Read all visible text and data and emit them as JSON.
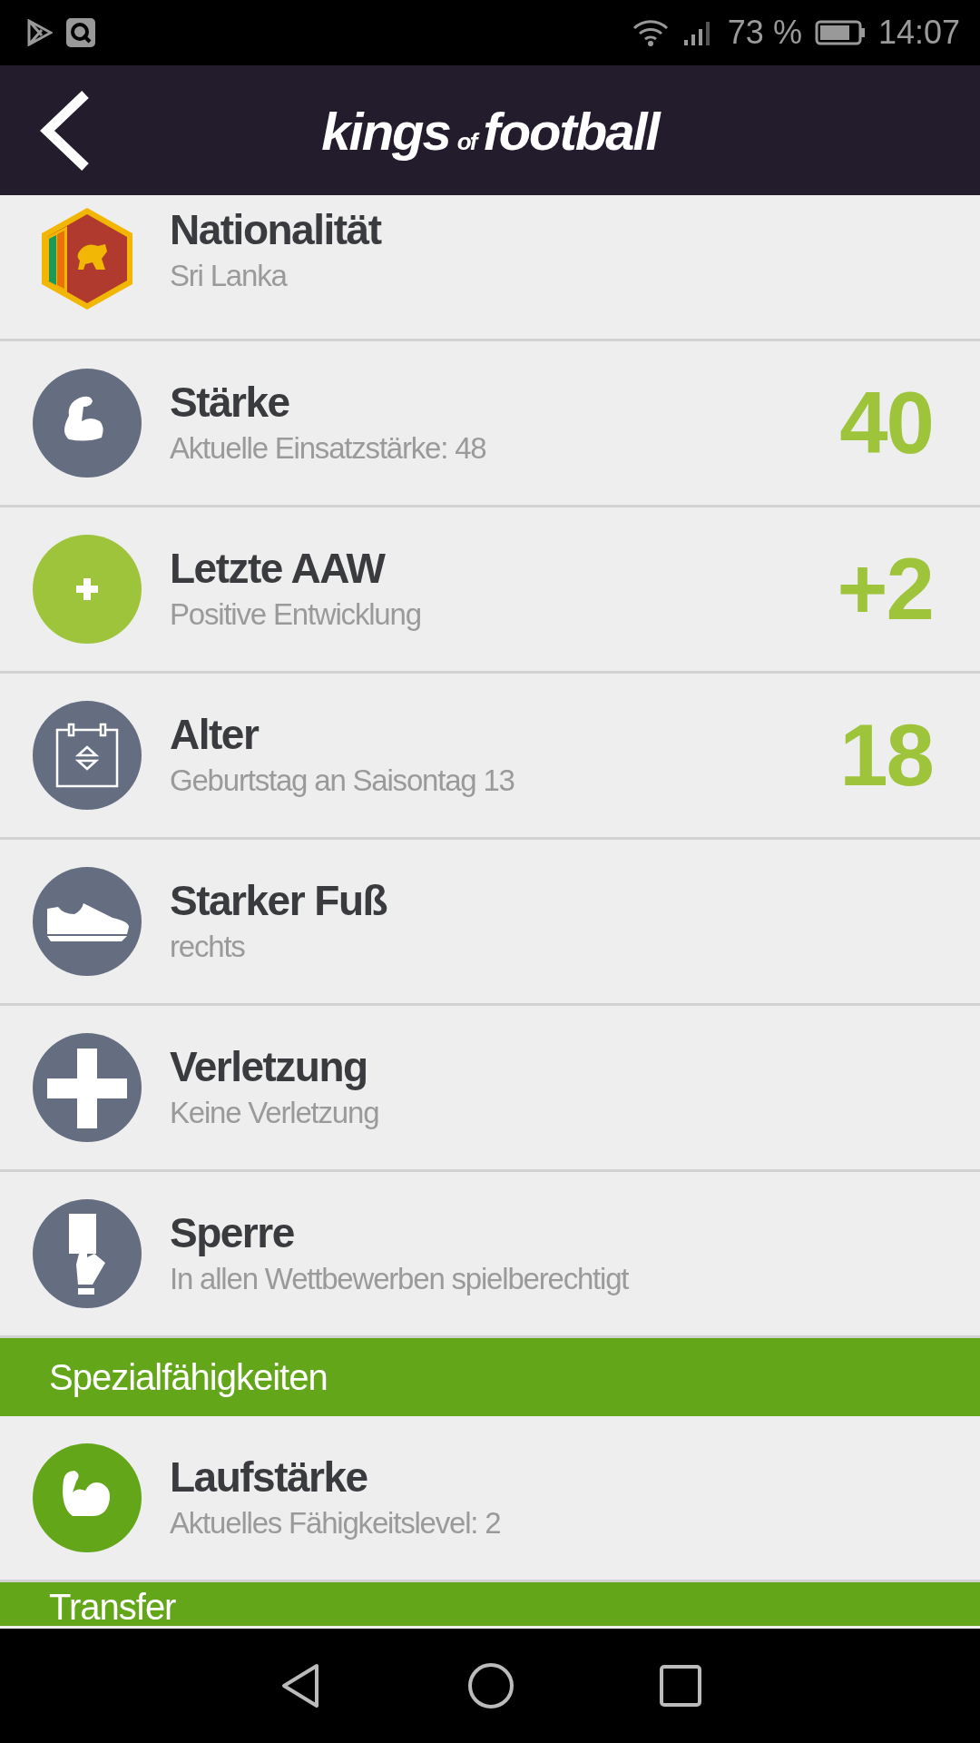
{
  "status_bar": {
    "battery": "73 %",
    "time": "14:07"
  },
  "header": {
    "logo": [
      {
        "text": "kings",
        "kind": "main"
      },
      {
        "text": "of",
        "kind": "small"
      },
      {
        "text": "football",
        "kind": "main"
      }
    ]
  },
  "sections": [
    {
      "rows": [
        {
          "kind": "flag",
          "color": "#b03a2e",
          "title": "Nationalität",
          "subtitle": "Sri Lanka"
        },
        {
          "kind": "muscle",
          "color": "#646e80",
          "title": "Stärke",
          "subtitle": "Aktuelle Einsatzstärke: 48",
          "value": "40"
        },
        {
          "kind": "plus",
          "color": "#9dc43a",
          "title": "Letzte AAW",
          "subtitle": "Positive Entwicklung",
          "value": "+2"
        },
        {
          "kind": "calendar",
          "color": "#646e80",
          "title": "Alter",
          "subtitle": "Geburtstag an Saisontag 13",
          "value": "18"
        },
        {
          "kind": "boot",
          "color": "#646e80",
          "title": "Starker Fuß",
          "subtitle": "rechts"
        },
        {
          "kind": "cross",
          "color": "#646e80",
          "title": "Verletzung",
          "subtitle": "Keine Verletzung"
        },
        {
          "kind": "card",
          "color": "#646e80",
          "title": "Sperre",
          "subtitle": "In allen Wettbewerben spielberechtigt"
        }
      ]
    },
    {
      "title": "Spezialfähigkeiten",
      "rows": [
        {
          "kind": "arm",
          "color": "#63a61a",
          "title": "Laufstärke",
          "subtitle": "Aktuelles Fähigkeitslevel: 2"
        }
      ]
    },
    {
      "title": "Transfer"
    }
  ]
}
